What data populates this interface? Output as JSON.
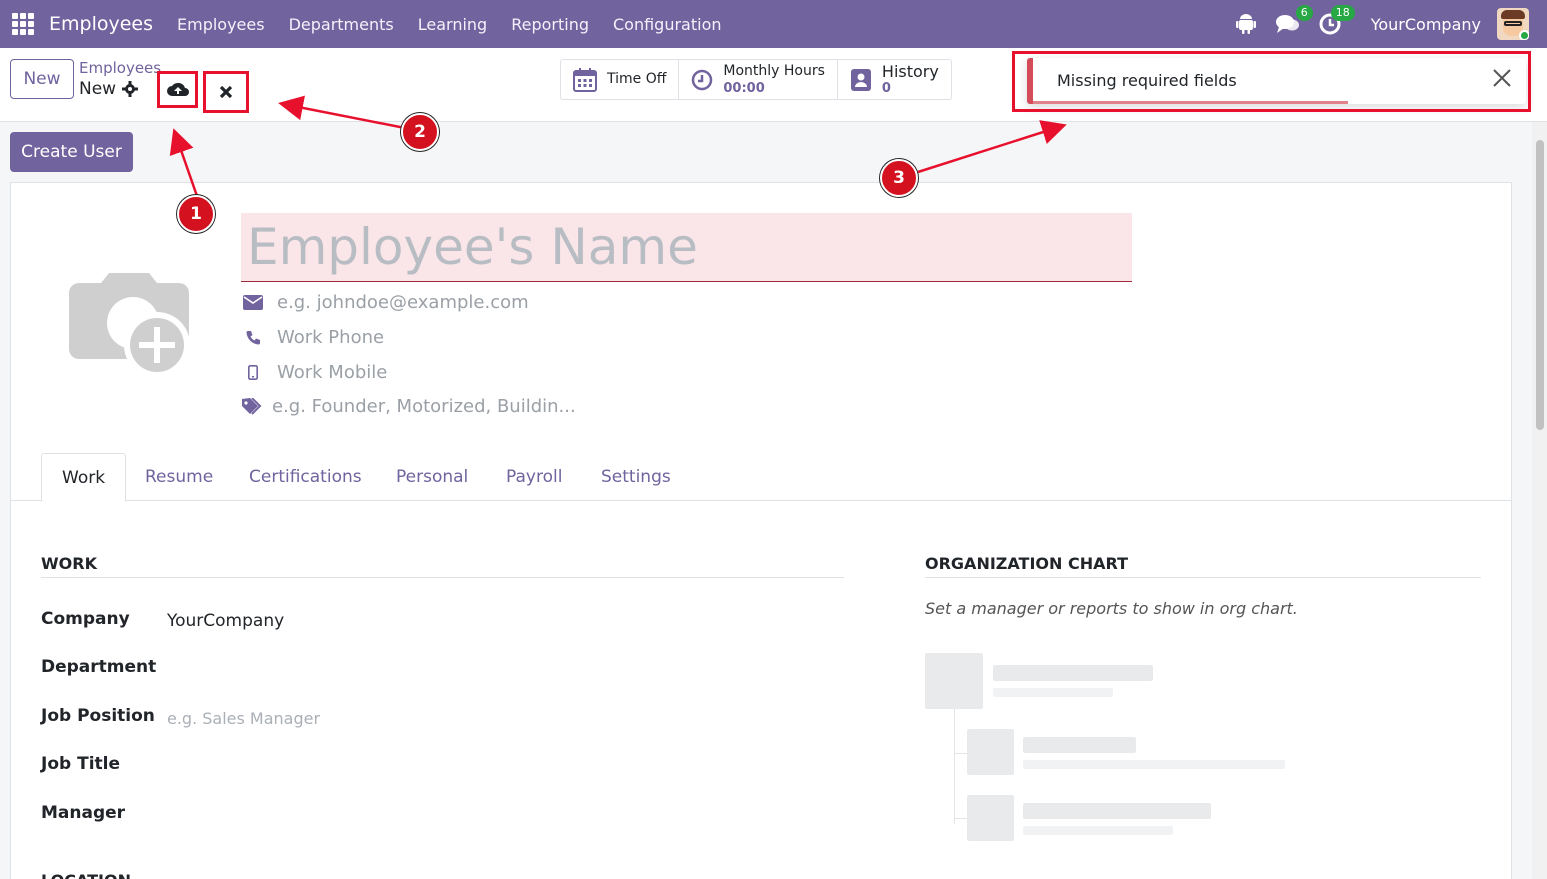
{
  "navbar": {
    "app_name": "Employees",
    "menu": [
      "Employees",
      "Departments",
      "Learning",
      "Reporting",
      "Configuration"
    ],
    "chat_count": "6",
    "activity_count": "18",
    "company": "YourCompany"
  },
  "control": {
    "new_label": "New",
    "breadcrumb": "Employees",
    "record_name": "New"
  },
  "smart_buttons": {
    "time_off": "Time Off",
    "monthly_hours_label": "Monthly Hours",
    "monthly_hours_value": "00:00",
    "history_label": "History",
    "history_value": "0"
  },
  "toast": {
    "message": "Missing required fields"
  },
  "create_user_label": "Create User",
  "form": {
    "name_placeholder": "Employee's Name",
    "email_placeholder": "e.g. johndoe@example.com",
    "phone_placeholder": "Work Phone",
    "mobile_placeholder": "Work Mobile",
    "tags_placeholder": "e.g. Founder, Motorized, Buildin..."
  },
  "tabs": [
    "Work",
    "Resume",
    "Certifications",
    "Personal",
    "Payroll",
    "Settings"
  ],
  "work_section": {
    "title": "WORK",
    "fields": [
      {
        "label": "Company",
        "value": "YourCompany"
      },
      {
        "label": "Department",
        "value": ""
      },
      {
        "label": "Job Position",
        "placeholder": "e.g. Sales Manager"
      },
      {
        "label": "Job Title",
        "value": ""
      },
      {
        "label": "Manager",
        "value": ""
      }
    ],
    "next_section": "LOCATION"
  },
  "org_chart": {
    "title": "ORGANIZATION CHART",
    "hint": "Set a manager or reports to show in org chart."
  },
  "annotations": [
    "1",
    "2",
    "3"
  ],
  "colors": {
    "brand": "#71639e",
    "error": "#d44c59",
    "annotation": "#e8112d"
  }
}
